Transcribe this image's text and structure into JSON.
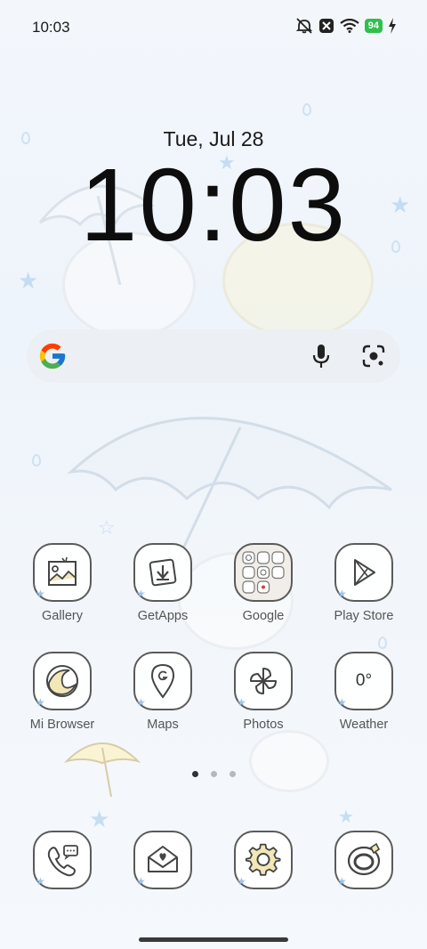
{
  "status_bar": {
    "time": "10:03",
    "battery_level": "94",
    "icons": [
      "mute-icon",
      "x-app-icon",
      "wifi-icon",
      "battery-icon",
      "charging-icon"
    ]
  },
  "clock": {
    "date": "Tue, Jul 28",
    "time": "10:03"
  },
  "search": {
    "icons": [
      "google-logo-icon",
      "mic-icon",
      "google-lens-icon"
    ]
  },
  "apps": {
    "row1": [
      {
        "label": "Gallery",
        "icon": "gallery-icon"
      },
      {
        "label": "GetApps",
        "icon": "getapps-icon"
      },
      {
        "label": "Google",
        "icon": "google-folder-icon"
      },
      {
        "label": "Play Store",
        "icon": "play-store-icon"
      }
    ],
    "row2": [
      {
        "label": "Mi Browser",
        "icon": "mi-browser-icon"
      },
      {
        "label": "Maps",
        "icon": "maps-icon"
      },
      {
        "label": "Photos",
        "icon": "photos-icon"
      },
      {
        "label": "Weather",
        "icon": "weather-icon",
        "temp": "0°"
      }
    ],
    "dock": [
      {
        "icon": "phone-icon"
      },
      {
        "icon": "messages-icon"
      },
      {
        "icon": "settings-icon"
      },
      {
        "icon": "security-icon"
      }
    ]
  },
  "pages": {
    "count": 3,
    "active": 1
  },
  "colors": {
    "battery": "#2fc04c",
    "icon_border": "#5a5a5a",
    "wallpaper_accent": "#b9d8f0"
  }
}
